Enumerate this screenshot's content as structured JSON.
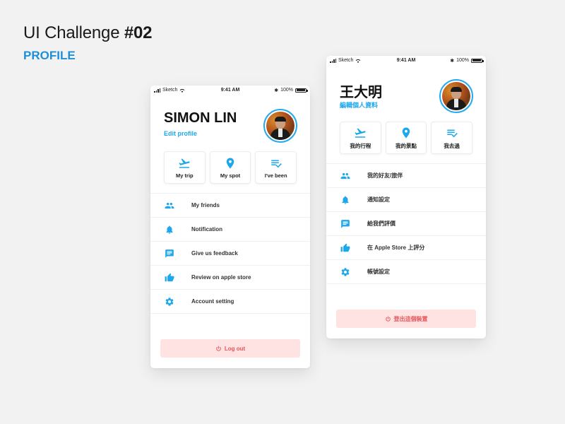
{
  "page": {
    "title_prefix": "UI Challenge ",
    "title_number": "#02",
    "subtitle": "PROFILE"
  },
  "colors": {
    "accent": "#1ea8ec",
    "subtitle": "#1e8fd8",
    "logout_bg": "#ffe3e3",
    "logout_text": "#e8545a",
    "background": "#f2f2f2"
  },
  "phones": [
    {
      "lang": "en",
      "status": {
        "carrier": "Sketch",
        "time": "9:41 AM",
        "battery": "100%",
        "battery_level": 1.0
      },
      "profile": {
        "name": "SIMON LIN",
        "edit_label": "Edit profile"
      },
      "quick_actions": [
        {
          "icon": "flight-takeoff-icon",
          "label": "My trip"
        },
        {
          "icon": "location-pin-icon",
          "label": "My spot"
        },
        {
          "icon": "checklist-icon",
          "label": "I've been"
        }
      ],
      "menu": [
        {
          "icon": "friends-icon",
          "label": "My friends"
        },
        {
          "icon": "bell-icon",
          "label": "Notification"
        },
        {
          "icon": "feedback-icon",
          "label": "Give us feedback"
        },
        {
          "icon": "thumbs-up-icon",
          "label": "Review on apple store"
        },
        {
          "icon": "gear-icon",
          "label": "Account setting"
        }
      ],
      "logout_label": "Log out"
    },
    {
      "lang": "zh",
      "status": {
        "carrier": "Sketch",
        "time": "9:41 AM",
        "battery": "100%",
        "battery_level": 1.0
      },
      "profile": {
        "name": "王大明",
        "edit_label": "編輯個人資料"
      },
      "quick_actions": [
        {
          "icon": "flight-takeoff-icon",
          "label": "我的行程"
        },
        {
          "icon": "location-pin-icon",
          "label": "我的景點"
        },
        {
          "icon": "checklist-icon",
          "label": "我去過"
        }
      ],
      "menu": [
        {
          "icon": "friends-icon",
          "label": "我的好友/旅伴"
        },
        {
          "icon": "bell-icon",
          "label": "通知設定"
        },
        {
          "icon": "feedback-icon",
          "label": "給我們評價"
        },
        {
          "icon": "thumbs-up-icon",
          "label": "在 Apple Store 上評分"
        },
        {
          "icon": "gear-icon",
          "label": "帳號設定"
        }
      ],
      "logout_label": "登出這個裝置"
    }
  ]
}
